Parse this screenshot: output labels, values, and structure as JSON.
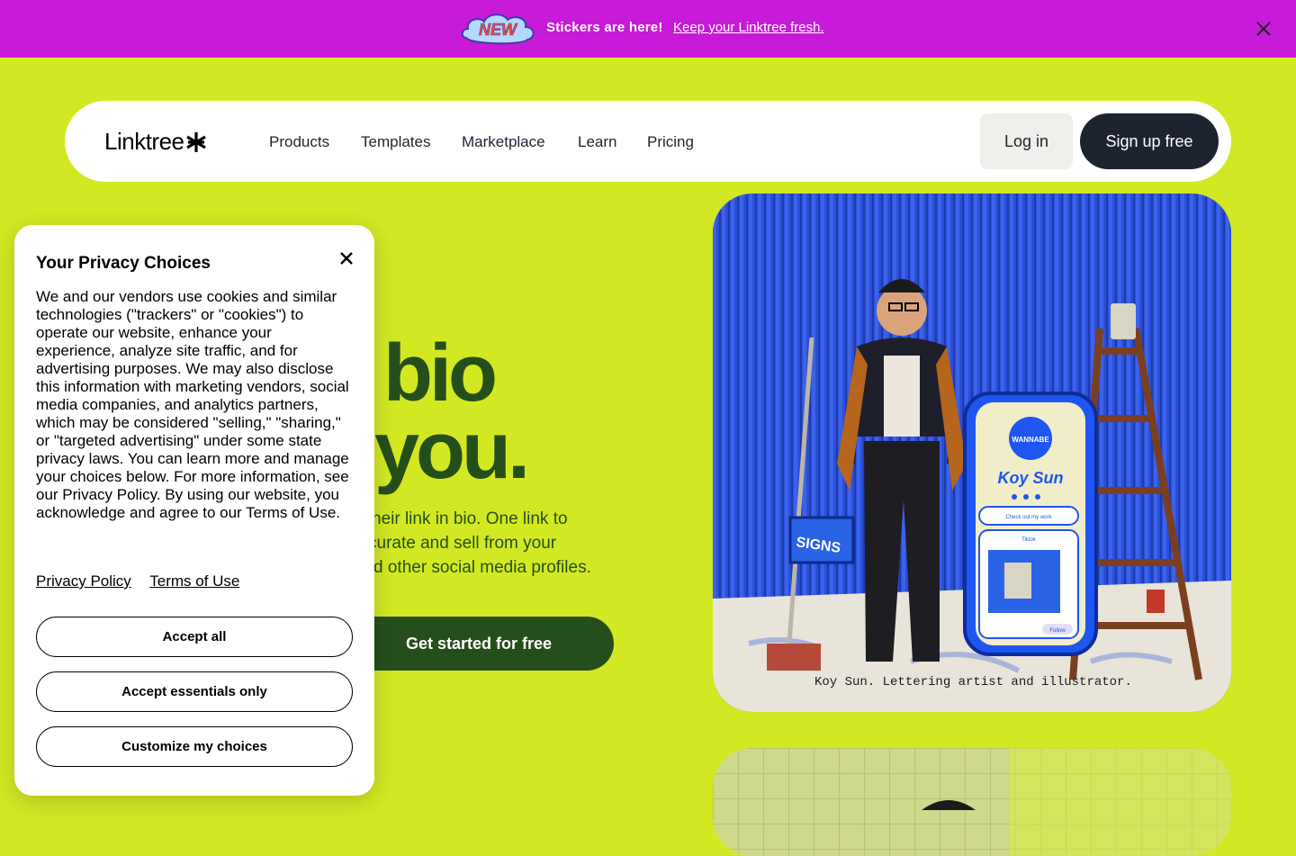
{
  "banner": {
    "badge_text": "NEW",
    "message": "Stickers are here!",
    "link": "Keep your Linktree fresh.",
    "bg_color": "#c81ad9"
  },
  "nav": {
    "logo": "Linktree",
    "links": [
      "Products",
      "Templates",
      "Marketplace",
      "Learn",
      "Pricing"
    ],
    "login": "Log in",
    "signup": "Sign up free"
  },
  "hero": {
    "line1": "bio",
    "line2": "you.",
    "para": [
      "heir link in bio. One link to",
      "curate and sell from your",
      "d other social media profiles."
    ],
    "cta": "Get started for free",
    "bg_color": "#d2e823",
    "text_color": "#254f1a"
  },
  "photo": {
    "caption": "Koy Sun. Lettering artist and illustrator.",
    "phone_name": "Koy Sun",
    "phone_badge": "WANNABE",
    "phone_link1": "Check out my work",
    "phone_link2": "Tiktok",
    "phone_follow": "Follow",
    "toolbox_text": "SIGNS"
  },
  "privacy": {
    "title": "Your Privacy Choices",
    "body": "We and our vendors use cookies and similar technologies (\"trackers\" or \"cookies\") to operate our website, enhance your experience, analyze site traffic, and for advertising purposes. We may also disclose this information with marketing vendors, social media companies, and analytics partners, which may be considered \"selling,\" \"sharing,\" or \"targeted advertising\" under some state privacy laws. You can learn more and manage your choices below. For more information, see our Privacy Policy. By using our website, you acknowledge and agree to our Terms of Use.",
    "privacy_link": "Privacy Policy",
    "terms_link": "Terms of Use",
    "accept_all": "Accept all",
    "accept_essentials": "Accept essentials only",
    "customize": "Customize my choices"
  }
}
